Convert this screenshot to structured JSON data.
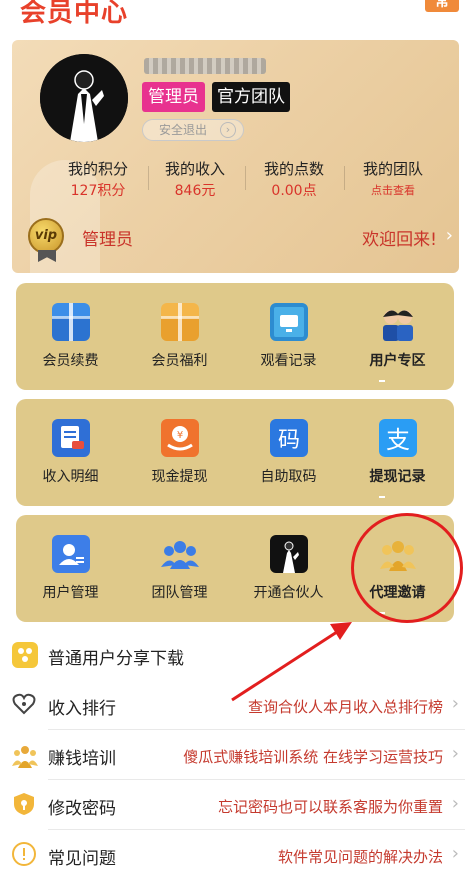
{
  "header": {
    "title": "会员中心",
    "corner_badge": "常"
  },
  "profile": {
    "admin_tag": "管理员",
    "team_tag": "官方团队",
    "logout_label": "安全退出",
    "stats": [
      {
        "label": "我的积分",
        "value": "127积分"
      },
      {
        "label": "我的收入",
        "value": "846元"
      },
      {
        "label": "我的点数",
        "value": "0.00点"
      },
      {
        "label": "我的团队",
        "value": "点击查看"
      }
    ],
    "vip_badge": "vip",
    "vip_role": "管理员",
    "welcome": "欢迎回来!"
  },
  "grid": {
    "row1": [
      {
        "label": "会员续费",
        "icon": "gift-icon"
      },
      {
        "label": "会员福利",
        "icon": "gift-box-icon"
      },
      {
        "label": "观看记录",
        "icon": "tv-icon"
      },
      {
        "label": "用户专区",
        "icon": "users-avatar-icon"
      }
    ],
    "row2": [
      {
        "label": "收入明细",
        "icon": "document-icon"
      },
      {
        "label": "现金提现",
        "icon": "cash-icon"
      },
      {
        "label": "自助取码",
        "icon": "code-icon"
      },
      {
        "label": "提现记录",
        "icon": "alipay-icon"
      }
    ],
    "row3": [
      {
        "label": "用户管理",
        "icon": "user-card-icon"
      },
      {
        "label": "团队管理",
        "icon": "team-icon"
      },
      {
        "label": "开通合伙人",
        "icon": "suit-icon"
      },
      {
        "label": "代理邀请",
        "icon": "gold-people-icon"
      }
    ]
  },
  "list": [
    {
      "label": "普通用户分享下载",
      "desc": "",
      "icon": "share-icon"
    },
    {
      "label": "收入排行",
      "desc": "查询合伙人本月收入总排行榜",
      "icon": "heart-icon"
    },
    {
      "label": "赚钱培训",
      "desc": "傻瓜式赚钱培训系统 在线学习运营技巧",
      "icon": "training-icon"
    },
    {
      "label": "修改密码",
      "desc": "忘记密码也可以联系客服为你重置",
      "icon": "shield-icon"
    },
    {
      "label": "常见问题",
      "desc": "软件常见问题的解决办法",
      "icon": "warning-icon"
    }
  ],
  "colors": {
    "accent": "#e8412b",
    "panel": "#dfc98a",
    "annotation": "#e21e1e"
  }
}
